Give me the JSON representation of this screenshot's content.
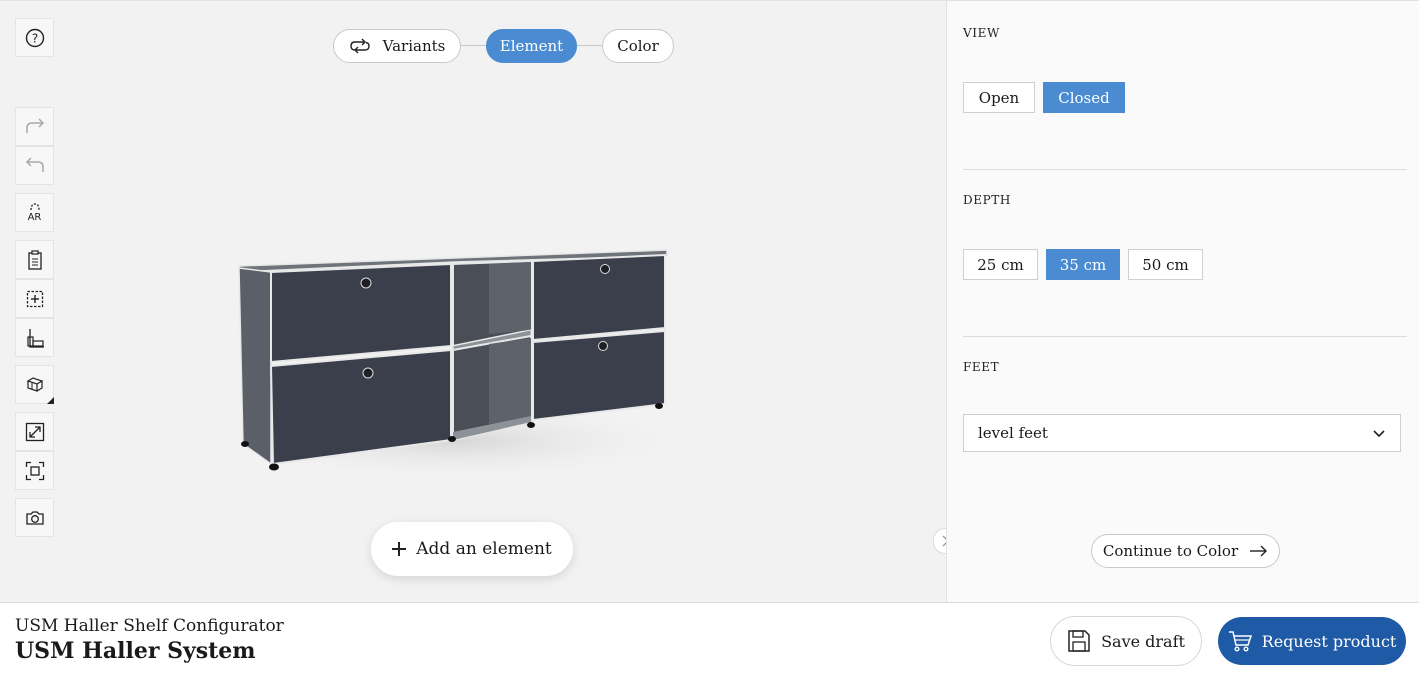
{
  "toolbar": {
    "tools": [
      "help-icon",
      "redo-icon",
      "undo-icon",
      "ar-icon",
      "clipboard-icon",
      "add-module-icon",
      "measure-icon",
      "view-cube-icon",
      "fullscreen-icon",
      "fit-view-icon",
      "camera-icon"
    ],
    "ar_label": "AR"
  },
  "stepper": {
    "steps": [
      {
        "label": "Variants",
        "icon": "variants-icon",
        "active": false
      },
      {
        "label": "Element",
        "active": true
      },
      {
        "label": "Color",
        "active": false
      }
    ]
  },
  "viewport": {
    "add_element_label": "Add an element",
    "shelf_color": "#3a3f4b"
  },
  "panel": {
    "view": {
      "title": "VIEW",
      "options": [
        "Open",
        "Closed"
      ],
      "selected": "Closed"
    },
    "depth": {
      "title": "DEPTH",
      "options": [
        "25 cm",
        "35 cm",
        "50 cm"
      ],
      "selected": "35 cm"
    },
    "feet": {
      "title": "FEET",
      "value": "level feet"
    },
    "continue_label": "Continue to Color"
  },
  "footer": {
    "subtitle": "USM Haller Shelf Configurator",
    "title": "USM Haller System",
    "save_label": "Save draft",
    "request_label": "Request product"
  },
  "colors": {
    "accent": "#4a8bd1",
    "primary_button": "#1f5aa6"
  }
}
